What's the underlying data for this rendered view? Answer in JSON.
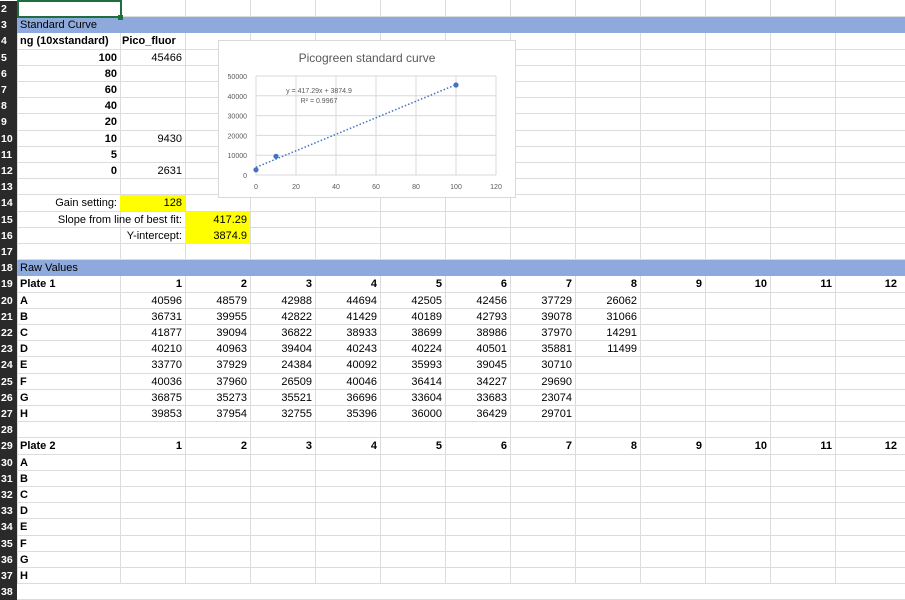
{
  "standard_curve": {
    "header": "Standard Curve",
    "col_a_header": "ng (10xstandard)",
    "col_b_header": "Pico_fluor",
    "ng": [
      "100",
      "80",
      "60",
      "40",
      "20",
      "10",
      "5",
      "0"
    ],
    "fluor": [
      "45466",
      "",
      "",
      "",
      "",
      "9430",
      "",
      "2631"
    ]
  },
  "settings": {
    "gain_label": "Gain setting:",
    "gain_value": "128",
    "slope_label": "Slope from line of best fit:",
    "slope_value": "417.29",
    "intercept_label": "Y-intercept:",
    "intercept_value": "3874.9"
  },
  "raw": {
    "header": "Raw Values",
    "plate1_label": "Plate 1",
    "plate2_label": "Plate 2",
    "columns": [
      "1",
      "2",
      "3",
      "4",
      "5",
      "6",
      "7",
      "8",
      "9",
      "10",
      "11",
      "12"
    ],
    "rows": [
      "A",
      "B",
      "C",
      "D",
      "E",
      "F",
      "G",
      "H"
    ],
    "plate1_values": [
      [
        "40596",
        "48579",
        "42988",
        "44694",
        "42505",
        "42456",
        "37729",
        "26062"
      ],
      [
        "36731",
        "39955",
        "42822",
        "41429",
        "40189",
        "42793",
        "39078",
        "31066"
      ],
      [
        "41877",
        "39094",
        "36822",
        "38933",
        "38699",
        "38986",
        "37970",
        "14291"
      ],
      [
        "40210",
        "40963",
        "39404",
        "40243",
        "40224",
        "40501",
        "35881",
        "11499"
      ],
      [
        "33770",
        "37929",
        "24384",
        "40092",
        "35993",
        "39045",
        "30710",
        ""
      ],
      [
        "40036",
        "37960",
        "26509",
        "40046",
        "36414",
        "34227",
        "29690",
        ""
      ],
      [
        "36875",
        "35273",
        "35521",
        "36696",
        "33604",
        "33683",
        "23074",
        ""
      ],
      [
        "39853",
        "37954",
        "32755",
        "35396",
        "36000",
        "36429",
        "29701",
        ""
      ]
    ]
  },
  "row_numbers": [
    "2",
    "3",
    "4",
    "5",
    "6",
    "7",
    "8",
    "9",
    "10",
    "11",
    "12",
    "13",
    "14",
    "15",
    "16",
    "17",
    "18",
    "19",
    "20",
    "21",
    "22",
    "23",
    "24",
    "25",
    "26",
    "27",
    "28",
    "29",
    "30",
    "31",
    "32",
    "33",
    "34",
    "35",
    "36",
    "37",
    "38"
  ],
  "chart_data": {
    "type": "scatter",
    "title": "Picogreen standard curve",
    "x": [
      0,
      10,
      100
    ],
    "y": [
      2631,
      9430,
      45466
    ],
    "xlim": [
      0,
      120
    ],
    "ylim": [
      0,
      50000
    ],
    "xticks": [
      "0",
      "20",
      "40",
      "60",
      "80",
      "100",
      "120"
    ],
    "yticks": [
      "0",
      "10000",
      "20000",
      "30000",
      "40000",
      "50000"
    ],
    "trendline": {
      "slope": 417.29,
      "intercept": 3874.9
    },
    "equation": "y = 417.29x + 3874.9",
    "r2": "R² = 0.9967",
    "grid": true,
    "marker_color": "#4472c4"
  }
}
